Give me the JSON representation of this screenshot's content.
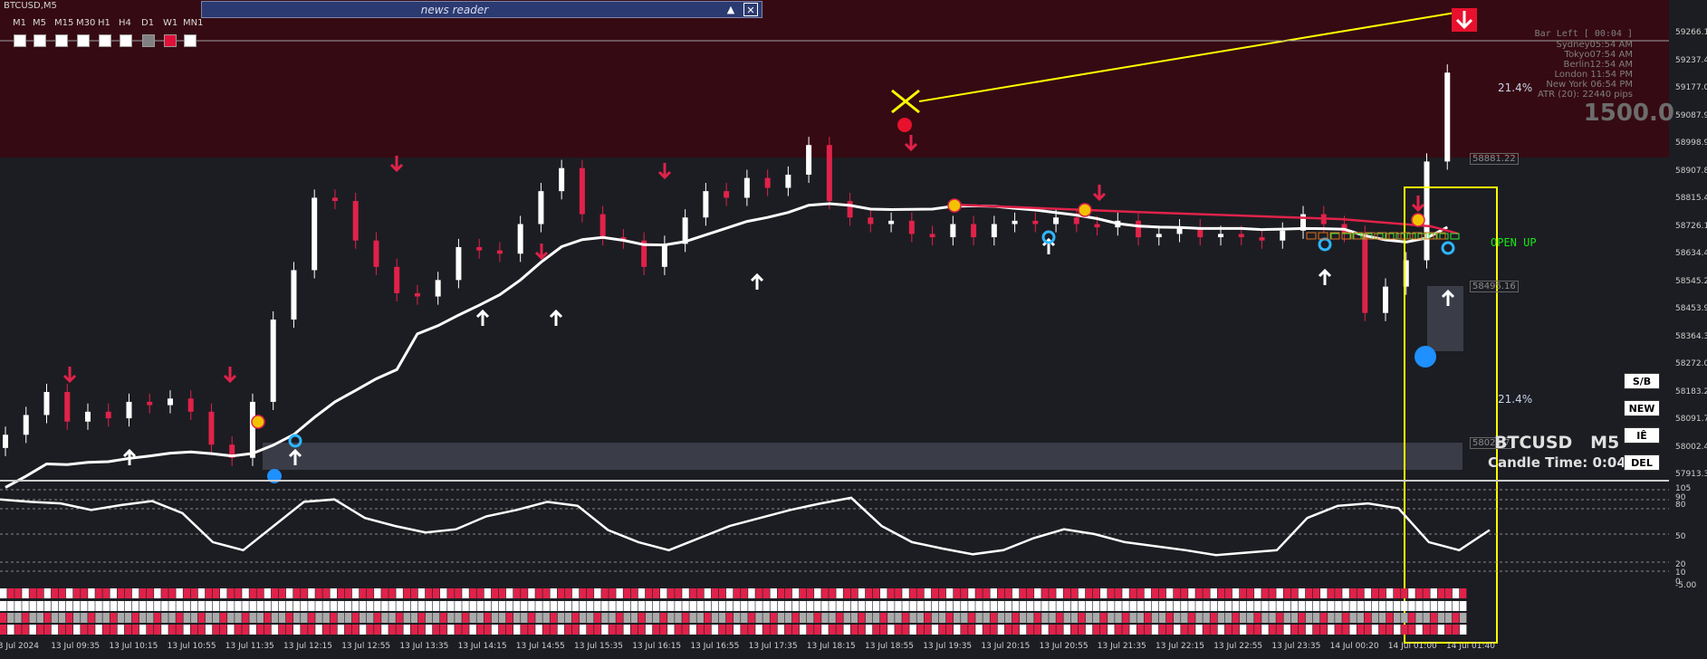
{
  "window": {
    "title": "BTCUSD,M5"
  },
  "timeframes": [
    "M1",
    "M5",
    "M15",
    "M30",
    "H1",
    "H4",
    "D1",
    "W1",
    "MN1"
  ],
  "timeframe_box_colors": [
    "#ffffff",
    "#ffffff",
    "#ffffff",
    "#ffffff",
    "#ffffff",
    "#ffffff",
    "#808080",
    "#e0103a",
    "#ffffff"
  ],
  "news_reader": {
    "title": "news reader",
    "minimize_icon": "triangle-up-icon",
    "close_icon": "close-icon"
  },
  "info_panel": {
    "bar_left": "Bar Left  [ 00:04 ]",
    "sydney": "Sydney05:54 AM",
    "tokyo": "Tokyo07:54 AM",
    "berlin": "Berlin12:54 AM",
    "london": "London 11:54 PM",
    "new_york": "New York 06:54 PM",
    "atr": "ATR (20): 22440 pips",
    "big_value": "1500.0"
  },
  "price_axis": [
    "59266.1",
    "59237.4",
    "59177.0",
    "59087.9",
    "58998.9",
    "58907.8",
    "58815.4",
    "58726.1",
    "58634.4",
    "58545.2",
    "58453.9",
    "58364.3",
    "58272.0",
    "58183.2",
    "58091.7",
    "58002.4",
    "57913.3"
  ],
  "subwindow_axis": [
    "105",
    "90",
    "80",
    "50",
    "20",
    "10",
    "0",
    "-5.00"
  ],
  "time_axis": [
    "13 Jul 2024",
    "13 Jul 09:35",
    "13 Jul 10:15",
    "13 Jul 10:55",
    "13 Jul 11:35",
    "13 Jul 12:15",
    "13 Jul 12:55",
    "13 Jul 13:35",
    "13 Jul 14:15",
    "13 Jul 14:55",
    "13 Jul 15:35",
    "13 Jul 16:15",
    "13 Jul 16:55",
    "13 Jul 17:35",
    "13 Jul 18:15",
    "13 Jul 18:55",
    "13 Jul 19:35",
    "13 Jul 20:15",
    "13 Jul 20:55",
    "13 Jul 21:35",
    "13 Jul 22:15",
    "13 Jul 22:55",
    "13 Jul 23:35",
    "14 Jul 00:20",
    "14 Jul 01:00",
    "14 Jul 01:40"
  ],
  "labels": {
    "pct_top": "21.4%",
    "pct_bottom": "21.4%",
    "open_up": "OPEN UP",
    "symbol": "BTCUSD",
    "timeframe": "M5",
    "candle_time": "Candle Time: 0:04",
    "inline_price_1": "58881.22",
    "inline_price_2": "58495.16",
    "inline_price_3": "58029.7"
  },
  "side_buttons": [
    "S/B",
    "NEW",
    "IÊ",
    "DEL"
  ],
  "colors": {
    "bull": "#ffffff",
    "bear": "#e0224a",
    "background": "#1c1d22",
    "supply_zone": "#360a12",
    "highlight": "#ffff00",
    "demand_zone": "#3a3c47"
  },
  "chart_data": {
    "type": "candlestick",
    "symbol": "BTCUSD",
    "timeframe": "M5",
    "x_range": [
      "13 Jul 2024",
      "14 Jul 01:40"
    ],
    "y_range": [
      57913.3,
      59266.1
    ],
    "close_series": [
      58050,
      58110,
      58180,
      58090,
      58120,
      58100,
      58150,
      58140,
      58160,
      58120,
      58020,
      57980,
      58150,
      58400,
      58550,
      58770,
      58760,
      58640,
      58560,
      58480,
      58470,
      58520,
      58620,
      58610,
      58600,
      58690,
      58790,
      58860,
      58720,
      58650,
      58640,
      58560,
      58630,
      58710,
      58790,
      58770,
      58830,
      58800,
      58840,
      58930,
      58760,
      58710,
      58690,
      58700,
      58660,
      58650,
      58690,
      58650,
      58690,
      58700,
      58690,
      58710,
      58690,
      58680,
      58700,
      58650,
      58660,
      58680,
      58650,
      58660,
      58650,
      58640,
      58670,
      58720,
      58690,
      58660,
      58420,
      58500,
      58580,
      58880,
      59150
    ]
  }
}
